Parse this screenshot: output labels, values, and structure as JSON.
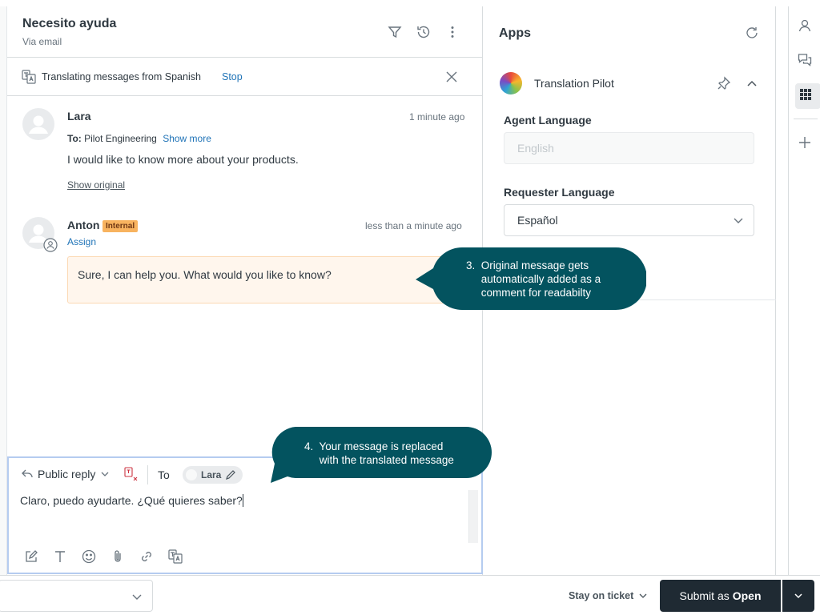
{
  "ticket": {
    "title": "Necesito ayuda",
    "channel": "Via email"
  },
  "translation_bar": {
    "text": "Translating messages from Spanish",
    "stop_label": "Stop"
  },
  "messages": [
    {
      "author": "Lara",
      "time": "1 minute ago",
      "to_label": "To:",
      "to_value": "Pilot Engineering",
      "show_more": "Show more",
      "body": "I would like to know more about your products.",
      "show_original": "Show original"
    },
    {
      "author": "Anton",
      "badge": "Internal",
      "time": "less than a minute ago",
      "assign": "Assign",
      "body": "Sure, I can help you. What would you like to know?"
    }
  ],
  "composer": {
    "reply_type": "Public reply",
    "to_label": "To",
    "recipient": "Lara",
    "text": "Claro, puedo ayudarte. ¿Qué quieres saber?"
  },
  "apps": {
    "title": "Apps",
    "app_name": "Translation Pilot",
    "agent_language_label": "Agent Language",
    "agent_language_value": "English",
    "requester_language_label": "Requester Language",
    "requester_language_value": "Español"
  },
  "callouts": {
    "c3_lines": [
      "3.  Original message gets",
      "     automatically added as a",
      "     comment for readabilty"
    ],
    "c4_lines": [
      "4.  Your message is replaced",
      "     with the translated message"
    ],
    "color": "#03535f"
  },
  "footer": {
    "stay_label": "Stay on ticket",
    "submit_prefix": "Submit as",
    "submit_status": "Open"
  }
}
